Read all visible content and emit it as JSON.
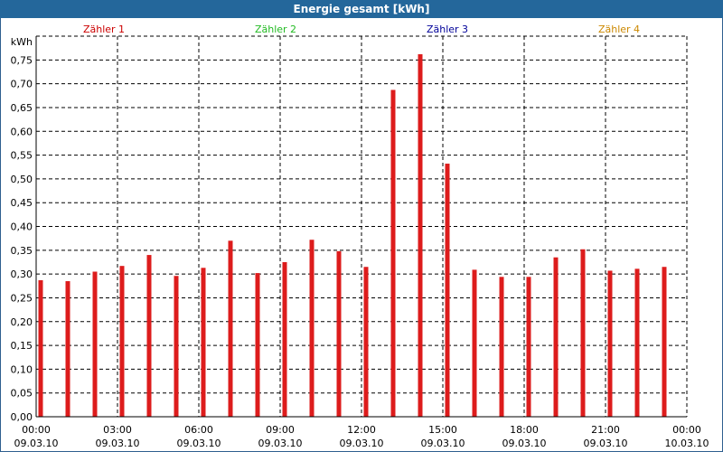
{
  "window": {
    "title": "Energie gesamt [kWh]"
  },
  "legend": [
    {
      "label": "Zähler 1",
      "color": "#cc0000"
    },
    {
      "label": "Zähler 2",
      "color": "#22bb22"
    },
    {
      "label": "Zähler 3",
      "color": "#000099"
    },
    {
      "label": "Zähler 4",
      "color": "#cc8800"
    }
  ],
  "chart_data": {
    "type": "bar",
    "title": "Energie gesamt [kWh]",
    "ylabel": "kWh",
    "xlabel": "",
    "ylim": [
      0,
      0.8
    ],
    "ytick_step": 0.05,
    "yticks": [
      "0,00",
      "0,05",
      "0,10",
      "0,15",
      "0,20",
      "0,25",
      "0,30",
      "0,35",
      "0,40",
      "0,45",
      "0,50",
      "0,55",
      "0,60",
      "0,65",
      "0,70",
      "0,75"
    ],
    "xticks": [
      {
        "time": "00:00",
        "date": "09.03.10"
      },
      {
        "time": "03:00",
        "date": "09.03.10"
      },
      {
        "time": "06:00",
        "date": "09.03.10"
      },
      {
        "time": "09:00",
        "date": "09.03.10"
      },
      {
        "time": "12:00",
        "date": "09.03.10"
      },
      {
        "time": "15:00",
        "date": "09.03.10"
      },
      {
        "time": "18:00",
        "date": "09.03.10"
      },
      {
        "time": "21:00",
        "date": "09.03.10"
      },
      {
        "time": "00:00",
        "date": "10.03.10"
      }
    ],
    "grid": true,
    "legend_position": "top",
    "bar_color": "#dd1c1c",
    "series": [
      {
        "name": "Zähler 1",
        "x": [
          "00:00",
          "01:00",
          "02:00",
          "03:00",
          "04:00",
          "05:00",
          "06:00",
          "07:00",
          "08:00",
          "09:00",
          "10:00",
          "11:00",
          "12:00",
          "13:00",
          "14:00",
          "15:00",
          "16:00",
          "17:00",
          "18:00",
          "19:00",
          "20:00",
          "21:00",
          "22:00",
          "23:00"
        ],
        "values": [
          0.287,
          0.285,
          0.305,
          0.317,
          0.34,
          0.296,
          0.313,
          0.37,
          0.302,
          0.325,
          0.372,
          0.348,
          0.315,
          0.687,
          0.762,
          0.532,
          0.309,
          0.294,
          0.294,
          0.335,
          0.352,
          0.307,
          0.311,
          0.315
        ]
      }
    ]
  }
}
